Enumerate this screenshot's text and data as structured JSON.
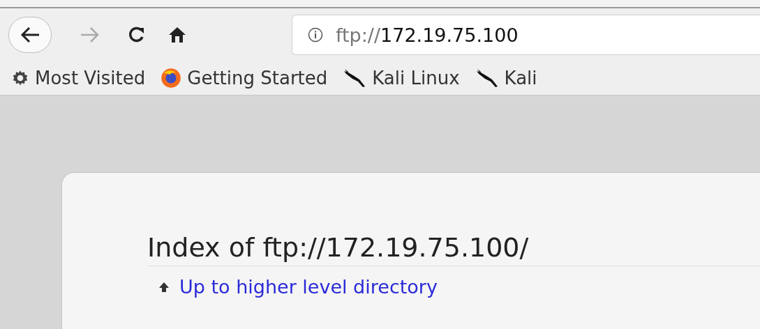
{
  "toolbar": {
    "address": "ftp://**172.19.75.100**"
  },
  "bookmarks": [
    {
      "kind": "gear",
      "label": "Most Visited"
    },
    {
      "kind": "firefox",
      "label": "Getting Started"
    },
    {
      "kind": "kali",
      "label": "Kali Linux"
    },
    {
      "kind": "kali",
      "label": "Kali"
    }
  ],
  "page": {
    "heading": "Index of ftp://172.19.75.100/",
    "parent_link": "Up to higher level directory"
  }
}
